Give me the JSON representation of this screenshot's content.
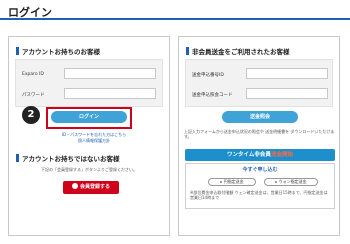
{
  "page": {
    "title": "ログイン"
  },
  "left": {
    "heading": "アカウントお持ちのお客様",
    "fields": [
      {
        "label": "Exparo ID"
      },
      {
        "label": "パスワード"
      }
    ],
    "login_button": "ログイン",
    "step_number": "2",
    "forgot_text": "ID・パスワードを忘れた方はこちら",
    "privacy_text": "個人情報保護方針",
    "no_account_heading": "アカウントお持ちではないお客様",
    "register_hint": "下記の「会員登録する」ボタンよりご登録ください。",
    "register_button": "会員登録する"
  },
  "right": {
    "heading": "非会員送金をご利用されたお客様",
    "fields": [
      {
        "label": "送金申込番号ID"
      },
      {
        "label": "送金申込照会コード"
      }
    ],
    "inquiry_button": "送金照会",
    "note": "上記入力フォームから送金申込状況の照会や 送金明細書を ダウンロードいただけます。",
    "onetime_banner_prefix": "ワンタイム非会員",
    "onetime_banner_accent": "送金開始",
    "apply_now": "今すぐ申し込む",
    "yen_button": "円指定送金",
    "won_button": "ウォン指定送金",
    "footnote": "※部位費金申込取付階額 ウェン確定送金は、営業日15時まで、円指定送金は営業日14時まで"
  }
}
